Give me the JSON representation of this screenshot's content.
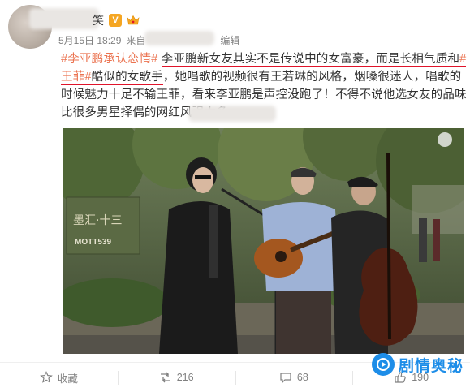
{
  "post": {
    "username": "笑",
    "verified_badge": "V",
    "date": "5月15日 18:29",
    "source_prefix": "来自",
    "edited": "编辑",
    "text_segments": [
      {
        "text": "#李亚鹏承认恋情#",
        "style": "hashtag"
      },
      {
        "text": " ",
        "style": "plain"
      },
      {
        "text": "李亚鹏新女友其实不是传说中的女富豪，而是长相气质和",
        "style": "underline"
      },
      {
        "text": "#王菲#",
        "style": "hashtag-underline"
      },
      {
        "text": "酷似的女歌手",
        "style": "underline"
      },
      {
        "text": "，她唱歌的视频很有王若琳的风格，烟嗓很迷人，唱歌的时候魅力十足不输王菲，看来李亚鹏是声控没跑了！不得不说他选女友的品味比很多男星择偶的网红风强太多",
        "style": "plain"
      }
    ],
    "video_sign_text": "MOTT539",
    "video_sign_chinese": "墨汇·十三"
  },
  "actions": [
    {
      "icon": "star-icon",
      "label": "收藏"
    },
    {
      "icon": "repost-icon",
      "label": "216"
    },
    {
      "icon": "comment-icon",
      "label": "68"
    },
    {
      "icon": "like-icon",
      "label": "190"
    }
  ],
  "watermark": {
    "label": "剧情奥秘"
  },
  "colors": {
    "hashtag": "#eb7350",
    "underline": "#e0132a",
    "meta": "#808080",
    "watermark": "#1d8de8"
  }
}
